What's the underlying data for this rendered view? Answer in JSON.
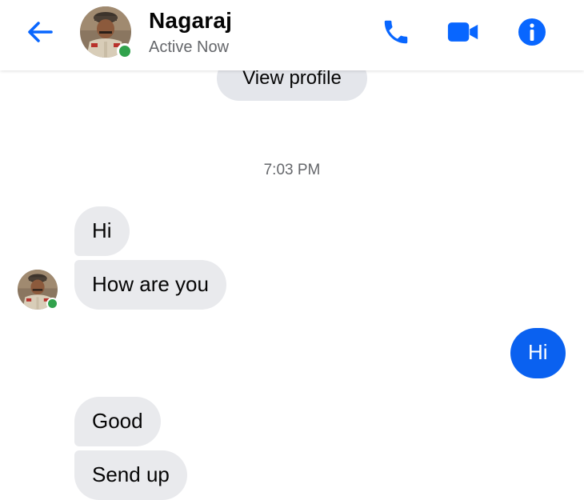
{
  "header": {
    "back_icon": "arrow-left-icon",
    "contact_name": "Nagaraj",
    "status": "Active Now",
    "actions": [
      {
        "name": "voice-call",
        "icon": "phone-icon"
      },
      {
        "name": "video-call",
        "icon": "video-camera-icon"
      },
      {
        "name": "info",
        "icon": "info-icon"
      }
    ]
  },
  "profile": {
    "view_profile_label": "View profile"
  },
  "conversation": {
    "timestamp": "7:03 PM",
    "messages": [
      {
        "direction": "incoming",
        "text": "Hi"
      },
      {
        "direction": "incoming",
        "text": "How are you"
      },
      {
        "direction": "outgoing",
        "text": "Hi"
      },
      {
        "direction": "incoming",
        "text": "Good"
      },
      {
        "direction": "incoming",
        "text": "Send up"
      }
    ]
  },
  "colors": {
    "accent": "#0a61f0",
    "icon_blue": "#0866ff",
    "incoming_bubble": "#e9eaed",
    "presence_green": "#31a24c",
    "secondary_text": "#65676b"
  }
}
